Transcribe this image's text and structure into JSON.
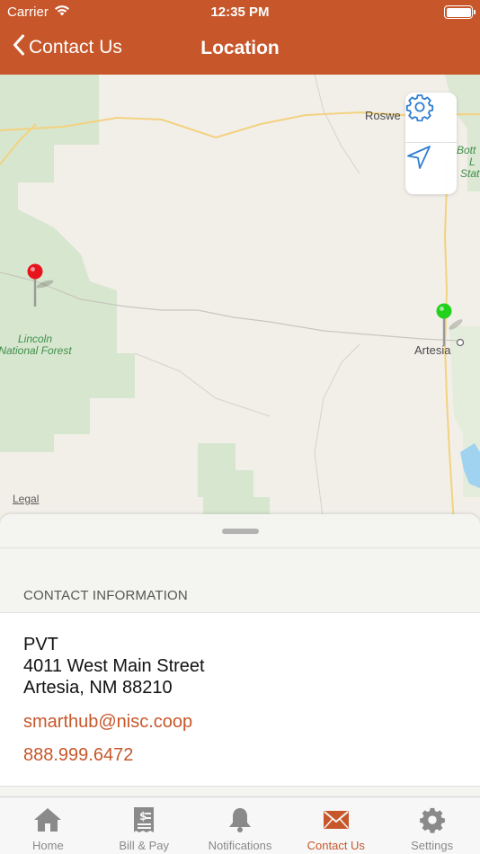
{
  "status_bar": {
    "carrier": "Carrier",
    "time": "12:35 PM"
  },
  "nav": {
    "back_label": "Contact Us",
    "title": "Location"
  },
  "map": {
    "labels": {
      "roswell": "Roswe",
      "lincoln_line1": "Lincoln",
      "lincoln_line2": "National Forest",
      "artesia": "Artesia",
      "bottomless_1": "Bott",
      "bottomless_2": "L",
      "bottomless_3": "Stat"
    },
    "legal": "Legal"
  },
  "contact": {
    "section_header": "CONTACT INFORMATION",
    "name": "PVT",
    "street": "4011 West Main Street",
    "city_state_zip": "Artesia, NM 88210",
    "email": "smarthub@nisc.coop",
    "phone": "888.999.6472"
  },
  "tabs": [
    {
      "label": "Home"
    },
    {
      "label": "Bill & Pay"
    },
    {
      "label": "Notifications"
    },
    {
      "label": "Contact Us"
    },
    {
      "label": "Settings"
    }
  ],
  "colors": {
    "brand": "#c7572b",
    "map_blue": "#2e7dd1",
    "pin_red": "#e8141d",
    "pin_green": "#22d11b"
  }
}
